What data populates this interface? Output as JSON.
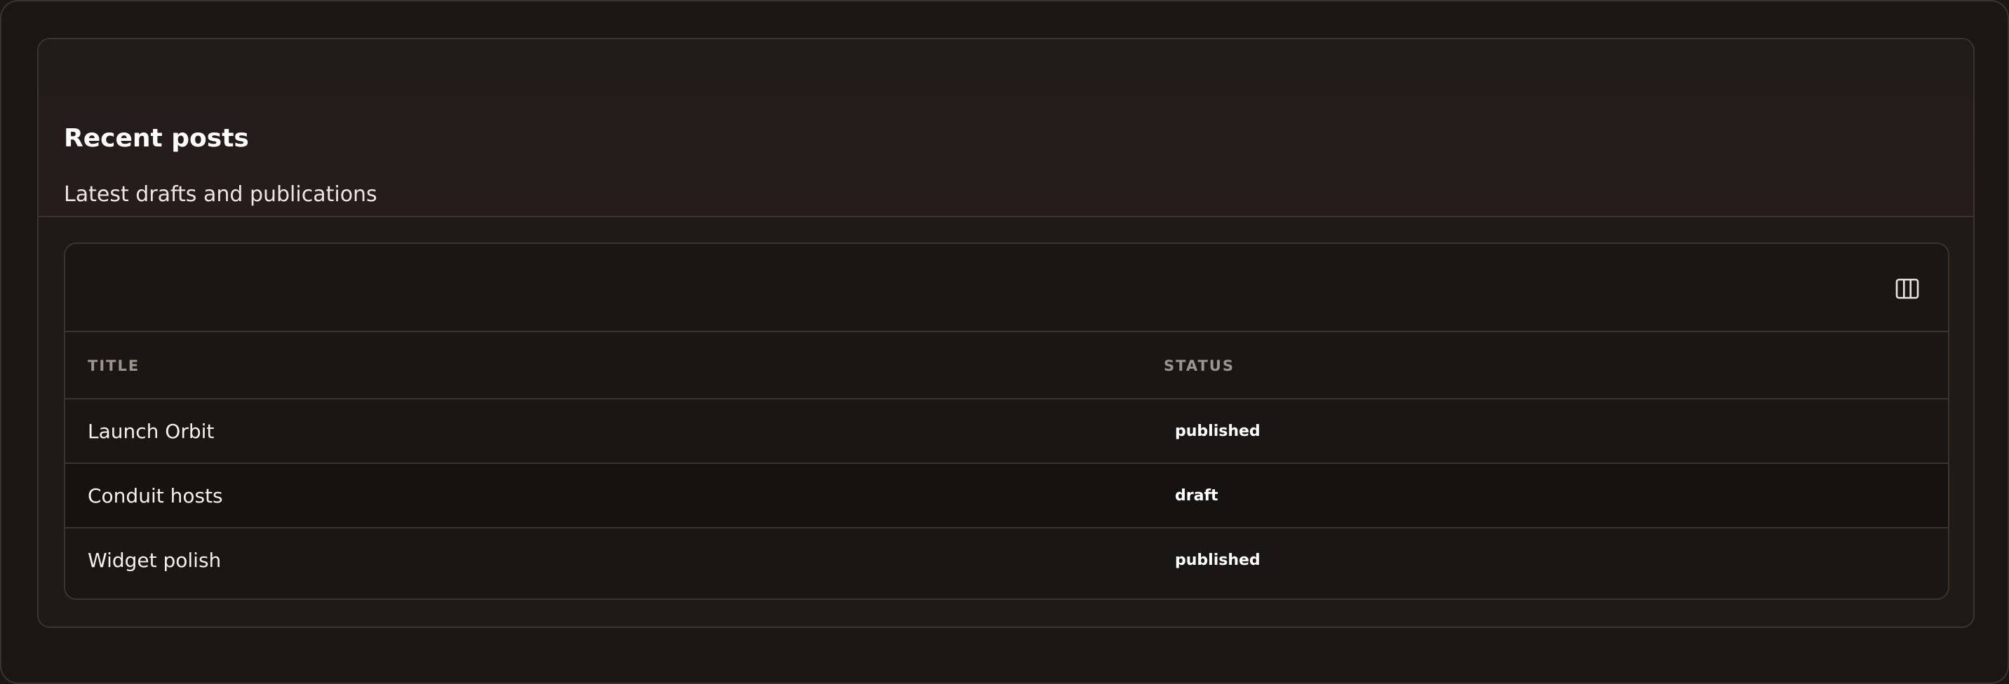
{
  "panel": {
    "title": "Recent posts",
    "subtitle": "Latest drafts and publications"
  },
  "toolbar": {
    "columns_icon": "columns-icon"
  },
  "table": {
    "headers": {
      "title": "TITLE",
      "status": "STATUS"
    },
    "rows": [
      {
        "title": "Launch Orbit",
        "status": "published"
      },
      {
        "title": "Conduit hosts",
        "status": "draft"
      },
      {
        "title": "Widget polish",
        "status": "published"
      }
    ]
  },
  "colors": {
    "background": "#1b1714",
    "card": "#201a17",
    "border": "#3a3330",
    "muted_text": "#9d948e",
    "text": "#f4f0ec"
  }
}
